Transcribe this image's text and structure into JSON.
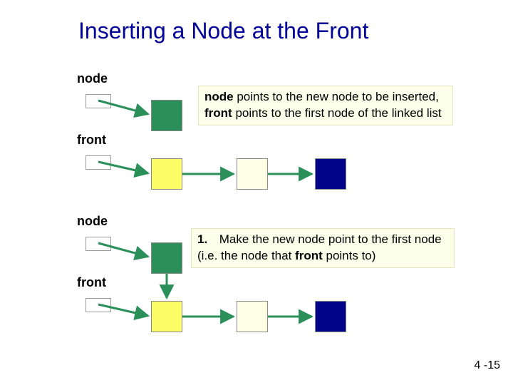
{
  "title": "Inserting a Node at the Front",
  "labels": {
    "node1": "node",
    "front1": "front",
    "node2": "node",
    "front2": "front"
  },
  "callout1": {
    "kw1": "node",
    "t1": " points to the new node to be inserted,  ",
    "kw2": "front",
    "t2": " points to the first node of the linked list"
  },
  "callout2": {
    "num": "1.",
    "lead": "Make the new node point to the first node (i.e. the node that ",
    "kw": "front",
    "tail": " points to)"
  },
  "pagenum": "4 -15",
  "chart_data": {
    "type": "diagram",
    "scenes": [
      {
        "pointers": [
          {
            "name": "node",
            "points_to": "new_green_node"
          },
          {
            "name": "front",
            "points_to": "list_head_yellow"
          }
        ],
        "nodes": [
          {
            "id": "new_green_node",
            "color": "green",
            "next": null
          },
          {
            "id": "list_head_yellow",
            "color": "yellow",
            "next": "n2_cream"
          },
          {
            "id": "n2_cream",
            "color": "cream",
            "next": "n3_navy"
          },
          {
            "id": "n3_navy",
            "color": "navy",
            "next": null
          }
        ],
        "caption": "node points to the new node to be inserted, front points to the first node of the linked list"
      },
      {
        "pointers": [
          {
            "name": "node",
            "points_to": "new_green_node"
          },
          {
            "name": "front",
            "points_to": "list_head_yellow"
          }
        ],
        "nodes": [
          {
            "id": "new_green_node",
            "color": "green",
            "next": "list_head_yellow"
          },
          {
            "id": "list_head_yellow",
            "color": "yellow",
            "next": "n2_cream"
          },
          {
            "id": "n2_cream",
            "color": "cream",
            "next": "n3_navy"
          },
          {
            "id": "n3_navy",
            "color": "navy",
            "next": null
          }
        ],
        "caption": "1. Make the new node point to the first node (i.e. the node that front points to)"
      }
    ]
  }
}
